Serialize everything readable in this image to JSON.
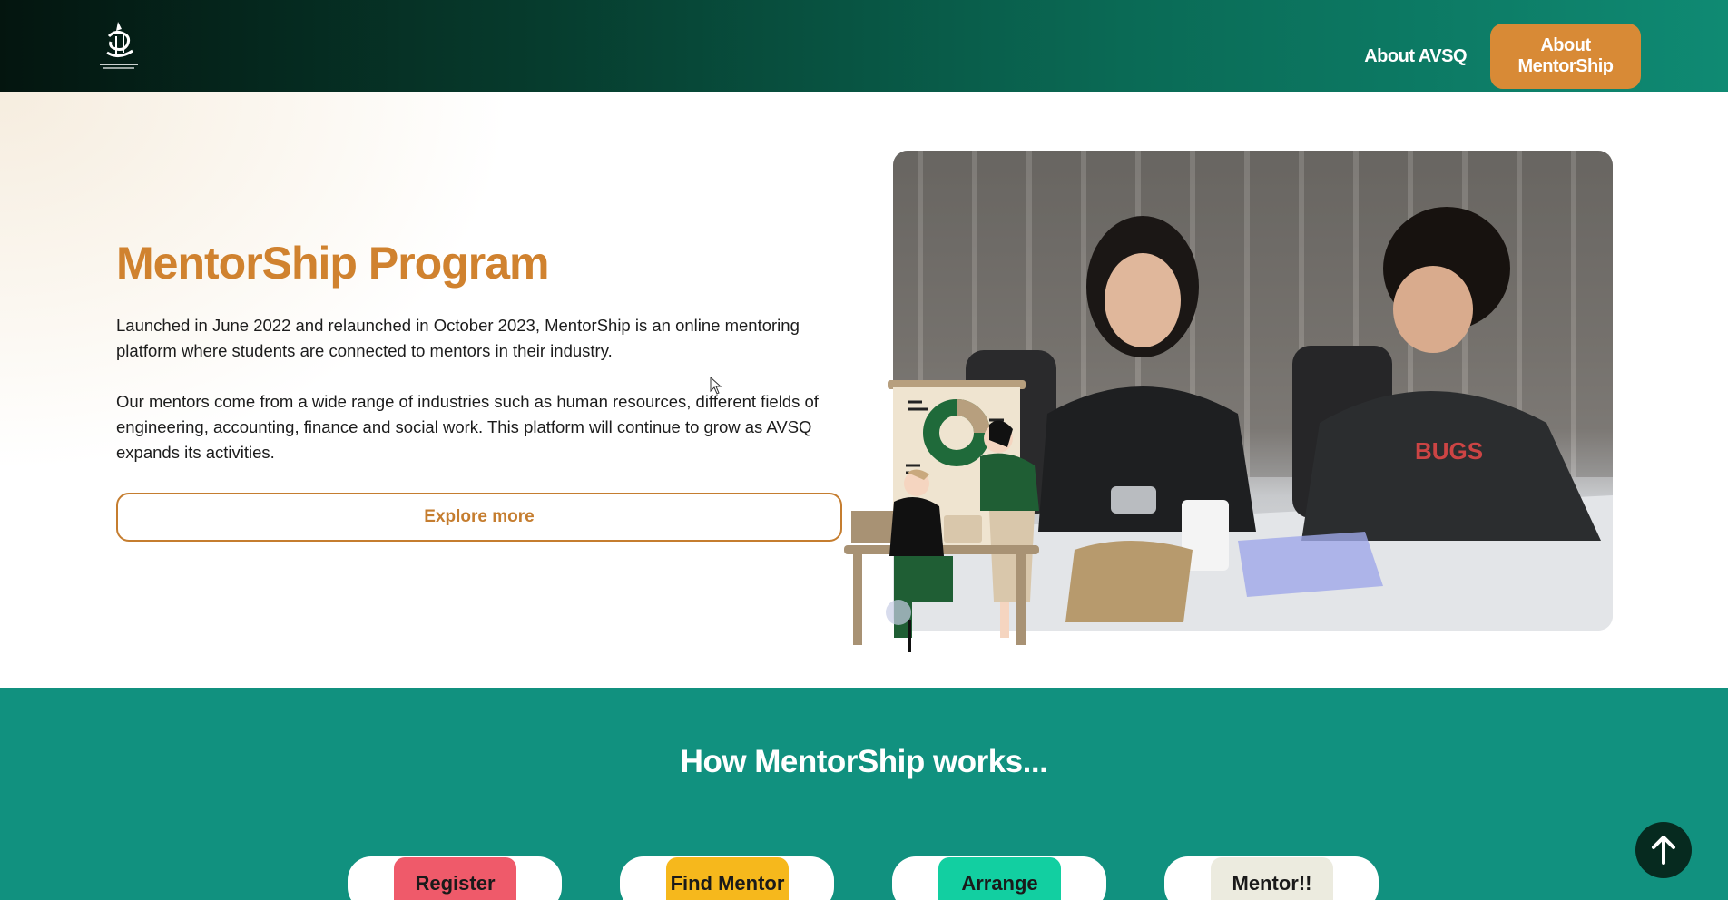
{
  "header": {
    "nav": {
      "about_avsq": "About AVSQ",
      "about_mentorship": "About MentorShip"
    }
  },
  "hero": {
    "title": "MentorShip Program",
    "paragraph1": "Launched in June 2022 and relaunched in October 2023, MentorShip is an online mentoring platform where students are connected to mentors in their industry.",
    "paragraph2": "Our mentors come from a wide range of industries such as human resources, different fields of engineering, accounting, finance and social work. This platform will continue to grow as AVSQ expands its activities.",
    "cta": "Explore more"
  },
  "how": {
    "title": "How MentorShip works...",
    "steps": [
      {
        "label": "Register",
        "color": "#ef5a6a"
      },
      {
        "label": "Find Mentor",
        "color": "#f6b81c"
      },
      {
        "label": "Arrange",
        "color": "#12cfa1"
      },
      {
        "label": "Mentor!!",
        "color": "#ecebdf"
      }
    ]
  },
  "icons": {
    "logo": "avsq-logo-icon",
    "scroll_top": "arrow-up-icon"
  },
  "colors": {
    "brand_orange": "#d0822f",
    "teal": "#11917f",
    "header_dark": "#04150f"
  }
}
